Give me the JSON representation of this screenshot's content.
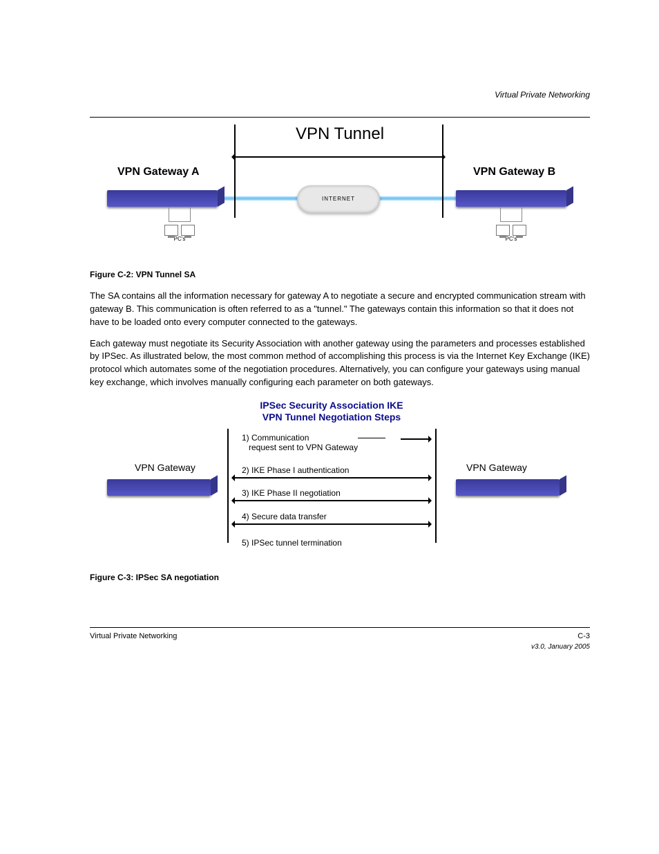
{
  "header_right": "Virtual Private Networking",
  "figure1": {
    "tunnel_label": "VPN Tunnel",
    "gateway_a": "VPN Gateway A",
    "gateway_b": "VPN Gateway B",
    "internet": "INTERNET",
    "pcs_label": "PC's"
  },
  "caption1": "Figure C-2:  VPN Tunnel SA",
  "para1": "The SA contains all the information necessary for gateway A to negotiate a secure and encrypted communication stream with gateway B. This communication is often referred to as a \"tunnel.\" The gateways contain this information so that it does not have to be loaded onto every computer connected to the gateways.",
  "para2": "Each gateway must negotiate its Security Association with another gateway using the parameters and processes established by IPSec. As illustrated below, the most common method of accomplishing this process is via the Internet Key Exchange (IKE) protocol which automates some of the negotiation procedures. Alternatively, you can configure your gateways using manual key exchange, which involves manually configuring each parameter on both gateways.",
  "figure2": {
    "title_line1": "IPSec Security Association IKE",
    "title_line2": "VPN Tunnel Negotiation Steps",
    "gw_label": "VPN Gateway",
    "step1a": "1) Communication",
    "step1b": "request sent to VPN Gateway",
    "step2": "2) IKE Phase I authentication",
    "step3": "3) IKE Phase II negotiation",
    "step4": "4) Secure data transfer",
    "step5": "5) IPSec tunnel termination"
  },
  "caption2": "Figure C-3:  IPSec SA negotiation",
  "footer": {
    "left": "Virtual Private Networking",
    "right": "C-3",
    "version": "v3.0, January 2005"
  }
}
